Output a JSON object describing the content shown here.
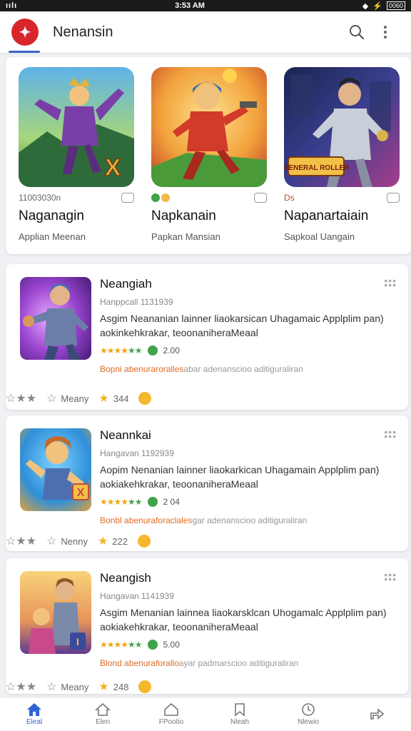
{
  "status_bar": {
    "left": "ıılı",
    "time": "3:53 AM",
    "battery": "0060"
  },
  "app_bar": {
    "title": "Nenansin",
    "logo_glyph": "✦"
  },
  "featured": [
    {
      "meta": "11003030n",
      "name": "Naganagin",
      "sub": "Applian Meenan",
      "badge": "X",
      "colors": [
        "#3c8fd0",
        "#7a3ea8",
        "#c9b24a"
      ]
    },
    {
      "meta": "",
      "name": "Napkanain",
      "sub": "Papkan Mansian",
      "badge": "",
      "colors": [
        "#f2b84c",
        "#d95d29",
        "#2f7fc8"
      ]
    },
    {
      "meta": "Ds",
      "name": "Napanartaiain",
      "sub": "Sapkoal Uangain",
      "badge": "GENERAL ROLLER",
      "colors": [
        "#1a2450",
        "#5b3d9a",
        "#c74f6a"
      ]
    }
  ],
  "list": [
    {
      "title": "Neangiah",
      "meta": "Hanppcall 1131939",
      "desc": "Asgim Neananian lainner liaokarsican Uhagamaic Applplim pan) aokinkehkrakar, teoonaniheraMeaal",
      "rating": "2.00",
      "tag_hl": "Bopni a",
      "tag_hl2": "benuraroralles",
      "tag_rest": "abar adenanscioo aditiguraliran",
      "act1": "",
      "act2": "Meany",
      "count": "344",
      "colors": [
        "#6b3ab0",
        "#b84fd0",
        "#d9c04a"
      ]
    },
    {
      "title": "Neannkai",
      "meta": "Hangavan 1192939",
      "desc": "Aopim Nenanian lainner liaokarkican Uhagamain Applplim pan) aokiakehkrakar, teoonaniheraMeaal",
      "rating": "2 04",
      "tag_hl": "Bonbl a",
      "tag_hl2": "benuraforaclales",
      "tag_rest": "gar adenanscioo aditiguraliran",
      "act1": "",
      "act2": "Nenny",
      "count": "222",
      "colors": [
        "#3a9fe0",
        "#f0a32e",
        "#c34a3a"
      ]
    },
    {
      "title": "Neangish",
      "meta": "Hangavan 1141939",
      "desc": "Asgim Menanian lainnea liaokarsklcan Uhogamalc Applplim pan) aokiakehkrakar, teoonaniheraMeaal",
      "rating": "5.00",
      "tag_hl": "Blond a",
      "tag_hl2": "benuraforallo",
      "tag_rest": "ayar padmarscioo aditiguraliran",
      "act1": "",
      "act2": "Meany",
      "count": "248",
      "colors": [
        "#f2c25a",
        "#5e3b8f",
        "#d6543a"
      ]
    }
  ],
  "bottom_nav": [
    {
      "label": "Eleal",
      "icon": "home-icon",
      "active": true
    },
    {
      "label": "Elen",
      "icon": "house-outline-icon",
      "active": false
    },
    {
      "label": "FPootio",
      "icon": "home-alt-icon",
      "active": false
    },
    {
      "label": "Nleah",
      "icon": "bookmark-icon",
      "active": false
    },
    {
      "label": "Nlewio",
      "icon": "clock-icon",
      "active": false
    },
    {
      "label": "",
      "icon": "share-icon",
      "active": false
    }
  ],
  "colors": {
    "accent": "#2e64d6",
    "brand": "#d8262c",
    "star": "#f2a51a"
  }
}
